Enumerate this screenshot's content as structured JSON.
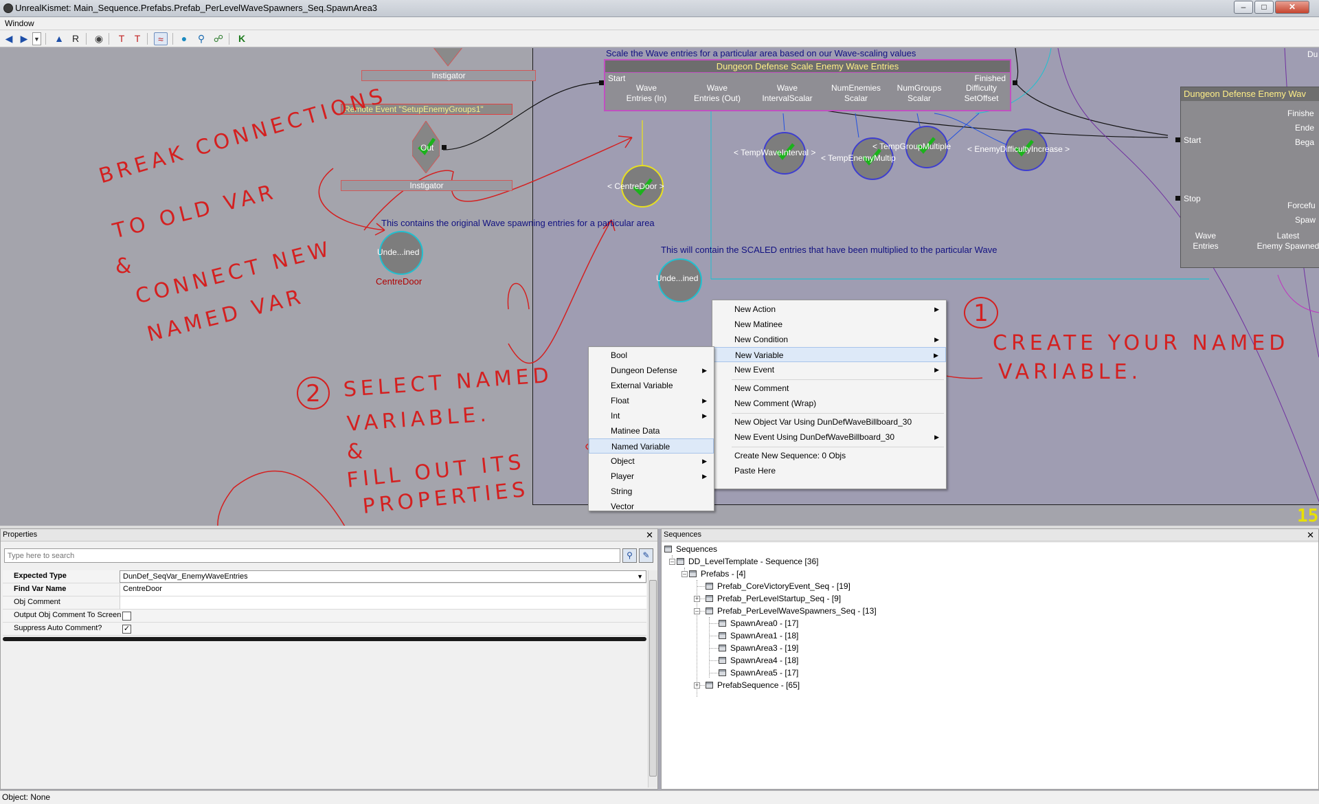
{
  "window": {
    "title": "UnrealKismet: Main_Sequence.Prefabs.Prefab_PerLevelWaveSpawners_Seq.SpawnArea3",
    "menu": [
      "Window"
    ]
  },
  "canvas": {
    "instigator_top": "Instigator",
    "remote_event": "Remote Event \"SetupEnemyGroups1\"",
    "out_label": "Out",
    "instigator_bottom": "Instigator",
    "comment_scale": "Scale the Wave entries for a particular area based on our Wave-scaling values",
    "comment_original": "This contains the original Wave spawning entries for a particular area",
    "comment_scaled": "This will contain the SCALED entries that have been multiplied to the particular Wave",
    "scale_action": {
      "title": "Dungeon Defense Scale Enemy Wave Entries",
      "start": "Start",
      "finished": "Finished",
      "pins": [
        "Wave\nEntries (In)",
        "Wave\nEntries (Out)",
        "Wave\nIntervalScalar",
        "NumEnemies\nScalar",
        "NumGroups\nScalar",
        "Difficulty\nSetOffset"
      ]
    },
    "wave_action": {
      "title": "Dungeon Defense Enemy Wav",
      "start": "Start",
      "stop": "Stop",
      "outs": [
        "Finishe",
        "Ende",
        "Bega",
        "Forcefu",
        "Spaw"
      ],
      "bottom_pins": [
        "Wave\nEntries",
        "Latest\nEnemy Spawned"
      ]
    },
    "vars": {
      "undefined_left": "Unde...ined",
      "centredoor_label": "CentreDoor",
      "centredoor_named": "< CentreDoor >",
      "undefined_right": "Unde...ined",
      "temp_wave_interval": "< TempWaveInterval >",
      "temp_enemy_multip": "< TempEnemyMultip",
      "temp_group_multiple": "< TempGroupMultiple",
      "enemy_difficulty": "< EnemyDifficultyIncrease >"
    },
    "side_letter": "Du",
    "badge": "15"
  },
  "context_menu_main": {
    "items": [
      {
        "label": "New Action",
        "submenu": true
      },
      {
        "label": "New Matinee",
        "submenu": false
      },
      {
        "label": "New Condition",
        "submenu": true
      },
      {
        "label": "New Variable",
        "submenu": true
      },
      {
        "label": "New Event",
        "submenu": true
      },
      {
        "label": "New Comment",
        "submenu": false
      },
      {
        "label": "New Comment (Wrap)",
        "submenu": false
      },
      {
        "label": "New Object Var Using DunDefWaveBillboard_30",
        "submenu": false
      },
      {
        "label": "New Event Using DunDefWaveBillboard_30",
        "submenu": true
      },
      {
        "label": "Create New Sequence: 0 Objs",
        "submenu": false
      },
      {
        "label": "Paste Here",
        "submenu": false
      }
    ]
  },
  "context_menu_variable": {
    "items": [
      {
        "label": "Bool",
        "submenu": false
      },
      {
        "label": "Dungeon Defense",
        "submenu": true
      },
      {
        "label": "External Variable",
        "submenu": false
      },
      {
        "label": "Float",
        "submenu": true
      },
      {
        "label": "Int",
        "submenu": true
      },
      {
        "label": "Matinee Data",
        "submenu": false
      },
      {
        "label": "Named Variable",
        "submenu": false
      },
      {
        "label": "Object",
        "submenu": true
      },
      {
        "label": "Player",
        "submenu": true
      },
      {
        "label": "String",
        "submenu": false
      },
      {
        "label": "Vector",
        "submenu": false
      }
    ]
  },
  "properties": {
    "title": "Properties",
    "search_placeholder": "Type here to search",
    "rows": [
      {
        "name": "Expected Type",
        "value": "DunDef_SeqVar_EnemyWaveEntries"
      },
      {
        "name": "Find Var Name",
        "value": "CentreDoor"
      },
      {
        "name": "Obj Comment",
        "value": ""
      },
      {
        "name": "Output Obj Comment To Screen",
        "checked": false
      },
      {
        "name": "Suppress Auto Comment?",
        "checked": true
      }
    ]
  },
  "sequences": {
    "title": "Sequences",
    "tree": [
      "Sequences",
      "DD_LevelTemplate - Sequence [36]",
      "Prefabs - [4]",
      "Prefab_CoreVictoryEvent_Seq - [19]",
      "Prefab_PerLevelStartup_Seq - [9]",
      "Prefab_PerLevelWaveSpawners_Seq - [13]",
      "SpawnArea0 - [17]",
      "SpawnArea1 - [18]",
      "SpawnArea3 - [19]",
      "SpawnArea4 - [18]",
      "SpawnArea5 - [17]",
      "PrefabSequence - [65]"
    ]
  },
  "status": "Object: None",
  "annotations": {
    "break_1": "BREAK CONNECTIONS",
    "break_2": "TO OLD VAR",
    "amp_1": "&",
    "connect_1": "CONNECT NEW",
    "connect_2": "NAMED VAR",
    "step1_num": "1",
    "create_1": "CREATE YOUR NAMED",
    "create_2": "VARIABLE.",
    "step2_num": "2",
    "select_1": "SELECT NAMED",
    "select_2": "VARIABLE.",
    "amp_2": "&",
    "fill_1": "FILL OUT ITS",
    "fill_2": "PROPERTIES"
  },
  "colors": {
    "annotation": "#d42020",
    "node_title": "#ffef88",
    "comment": "#101080",
    "wire_cyan": "#20c0d0",
    "wire_blue": "#2050e0"
  }
}
